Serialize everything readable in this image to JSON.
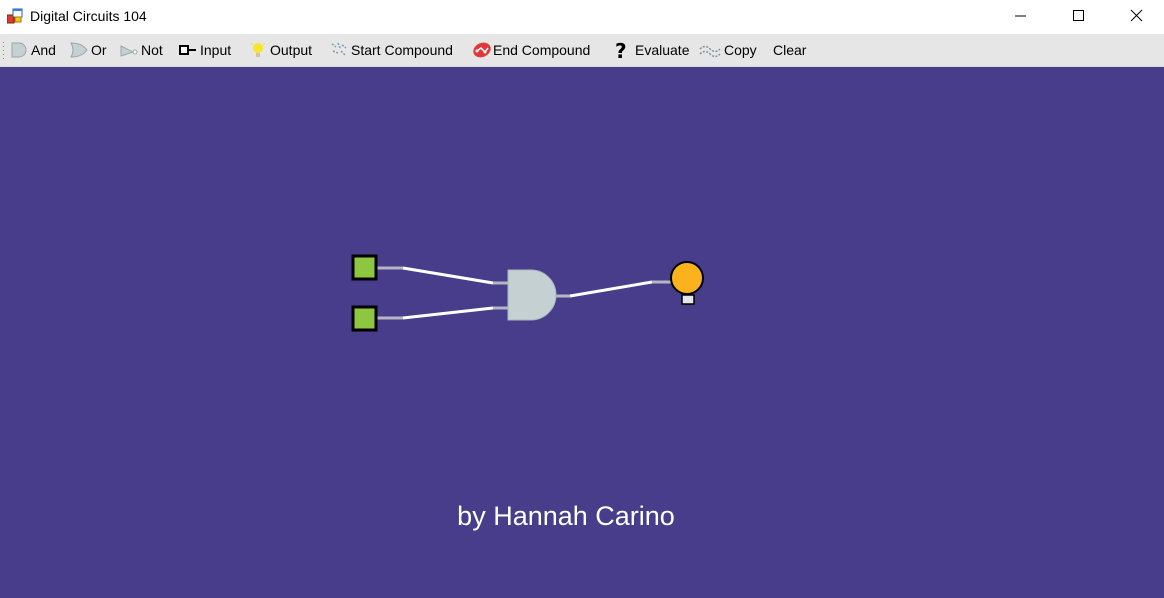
{
  "window": {
    "title": "Digital Circuits 104",
    "icon": "app-icon",
    "controls": [
      "minimize-icon",
      "maximize-icon",
      "close-icon"
    ]
  },
  "toolbar": {
    "items": [
      {
        "label": "And",
        "icon": "and-gate-icon"
      },
      {
        "label": "Or",
        "icon": "or-gate-icon"
      },
      {
        "label": "Not",
        "icon": "not-gate-icon"
      },
      {
        "label": "Input",
        "icon": "input-icon"
      },
      {
        "label": "Output",
        "icon": "bulb-icon"
      },
      {
        "label": "Start Compound",
        "icon": "start-compound-icon"
      },
      {
        "label": "End Compound",
        "icon": "end-compound-icon"
      },
      {
        "label": "Evaluate",
        "icon": "question-icon"
      },
      {
        "label": "Copy",
        "icon": "copy-icon"
      },
      {
        "label": "Clear",
        "icon": ""
      }
    ]
  },
  "canvas": {
    "background": "#483d8b",
    "credit": "by Hannah Carino",
    "components": [
      {
        "type": "input",
        "name": "input-1",
        "color": "#8dc63f"
      },
      {
        "type": "input",
        "name": "input-2",
        "color": "#8dc63f"
      },
      {
        "type": "and-gate",
        "name": "and-gate",
        "color": "#c5d0d3"
      },
      {
        "type": "output",
        "name": "output-bulb",
        "color": "#fbb21d"
      }
    ],
    "wire_color": "#ffffff"
  }
}
